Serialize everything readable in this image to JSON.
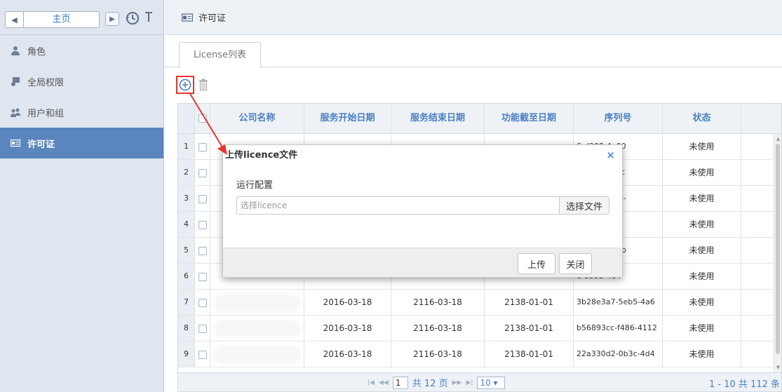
{
  "sidebar": {
    "home_label": "主页",
    "items": [
      {
        "label": "角色",
        "icon": "user-icon",
        "active": false
      },
      {
        "label": "全局权限",
        "icon": "global-permission-icon",
        "active": false
      },
      {
        "label": "用户和组",
        "icon": "users-group-icon",
        "active": false
      },
      {
        "label": "许可证",
        "icon": "license-card-icon",
        "active": true
      }
    ]
  },
  "header": {
    "title": "许可证",
    "icon": "license-card-icon"
  },
  "tabs": [
    {
      "label": "License列表"
    }
  ],
  "toolbar": {
    "add_icon": "plus-circle-icon",
    "delete_icon": "trash-icon"
  },
  "table": {
    "columns": [
      "公司名称",
      "服务开始日期",
      "服务结束日期",
      "功能截至日期",
      "序列号",
      "状态"
    ],
    "rows": [
      {
        "num": "1",
        "company": "",
        "start": "",
        "end": "",
        "feature": "",
        "serial": "6-d208-4a00",
        "status": "未使用"
      },
      {
        "num": "2",
        "company": "",
        "start": "",
        "end": "",
        "feature": "",
        "serial": "7-880c-453c",
        "status": "未使用"
      },
      {
        "num": "3",
        "company": "",
        "start": "",
        "end": "",
        "feature": "",
        "serial": "0-c2f2-4700-",
        "status": "未使用"
      },
      {
        "num": "4",
        "company": "",
        "start": "",
        "end": "",
        "feature": "",
        "serial": "9-799b-403",
        "status": "未使用"
      },
      {
        "num": "5",
        "company": "",
        "start": "",
        "end": "",
        "feature": "",
        "serial": "3-632b-473b",
        "status": "未使用"
      },
      {
        "num": "6",
        "company": "",
        "start": "",
        "end": "",
        "feature": "",
        "serial": "e-8b93-4e4",
        "status": "未使用"
      },
      {
        "num": "7",
        "company": "",
        "start": "2016-03-18",
        "end": "2116-03-18",
        "feature": "2138-01-01",
        "serial": "3b28e3a7-5eb5-4a6",
        "status": "未使用"
      },
      {
        "num": "8",
        "company": "",
        "start": "2016-03-18",
        "end": "2116-03-18",
        "feature": "2138-01-01",
        "serial": "b56893cc-f486-4112",
        "status": "未使用"
      },
      {
        "num": "9",
        "company": "",
        "start": "2016-03-18",
        "end": "2116-03-18",
        "feature": "2138-01-01",
        "serial": "22a330d2-0b3c-4d4",
        "status": "未使用"
      }
    ]
  },
  "pager": {
    "page": "1",
    "total_pages": "共 12 页",
    "page_size": "10 ▾",
    "summary": "1 - 10  共 112 条"
  },
  "modal": {
    "title": "上传licence文件",
    "close": "×",
    "section_label": "运行配置",
    "input_placeholder": "选择licence",
    "choose_file": "选择文件",
    "upload": "上传",
    "close_button": "关闭"
  },
  "colors": {
    "sidebar_bg": "#dfe6ef",
    "active_bg": "#5b86bd",
    "accent": "#4a7fc1",
    "annotation": "#e8342e"
  }
}
